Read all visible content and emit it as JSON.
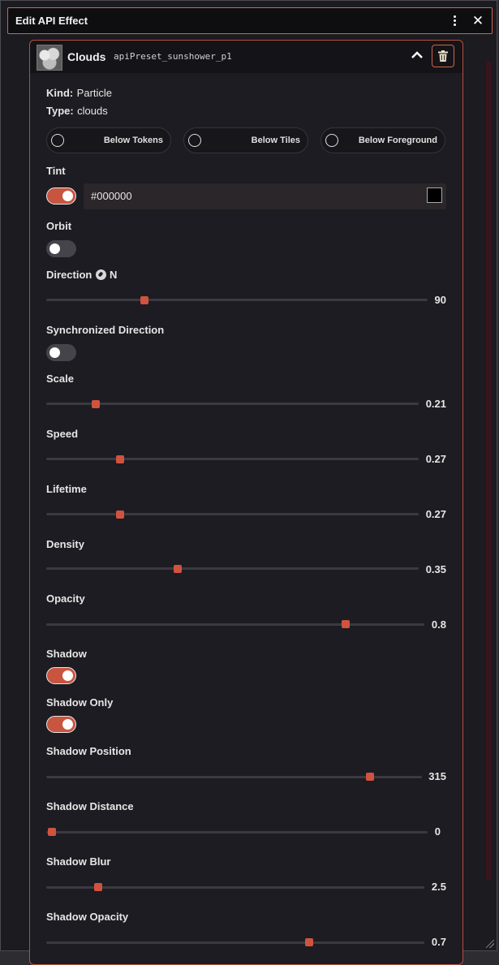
{
  "window": {
    "title": "Edit API Effect"
  },
  "effect": {
    "name": "Clouds",
    "preset_id": "apiPreset_sunshower_p1",
    "kind_label": "Kind:",
    "kind_value": "Particle",
    "type_label": "Type:",
    "type_value": "clouds"
  },
  "layers": [
    {
      "label": "Below Tokens",
      "selected": false
    },
    {
      "label": "Below Tiles",
      "selected": false
    },
    {
      "label": "Below Foreground",
      "selected": false
    }
  ],
  "tint": {
    "label": "Tint",
    "enabled": true,
    "color_text": "#000000",
    "swatch_color": "#000000"
  },
  "orbit": {
    "label": "Orbit",
    "enabled": false
  },
  "direction": {
    "label": "Direction",
    "compass_letter": "N",
    "value": "90",
    "min": 0,
    "max": 360
  },
  "sync_direction": {
    "label": "Synchronized Direction",
    "enabled": false
  },
  "sliders": {
    "scale": {
      "label": "Scale",
      "value": "0.21",
      "fraction": 0.13
    },
    "speed": {
      "label": "Speed",
      "value": "0.27",
      "fraction": 0.2
    },
    "lifetime": {
      "label": "Lifetime",
      "value": "0.27",
      "fraction": 0.2
    },
    "density": {
      "label": "Density",
      "value": "0.35",
      "fraction": 0.35
    },
    "opacity": {
      "label": "Opacity",
      "value": "0.8",
      "fraction": 0.8
    },
    "shadow_position": {
      "label": "Shadow Position",
      "value": "315",
      "fraction": 0.875
    },
    "shadow_distance": {
      "label": "Shadow Distance",
      "value": "0",
      "fraction": 0.0
    },
    "shadow_blur": {
      "label": "Shadow Blur",
      "value": "2.5",
      "fraction": 0.14
    },
    "shadow_opacity": {
      "label": "Shadow Opacity",
      "value": "0.7",
      "fraction": 0.7
    }
  },
  "shadow": {
    "label": "Shadow",
    "enabled": true
  },
  "shadow_only": {
    "label": "Shadow Only",
    "enabled": true
  },
  "colors": {
    "accent": "#d0533f",
    "panel_border": "#b4503f",
    "background": "#1b1b20"
  },
  "icons": {
    "kebab": "vertical-dots-icon",
    "close": "close-icon",
    "collapse": "chevron-up-icon",
    "delete": "trash-icon",
    "compass": "compass-icon",
    "preview": "clouds-thumbnail"
  }
}
